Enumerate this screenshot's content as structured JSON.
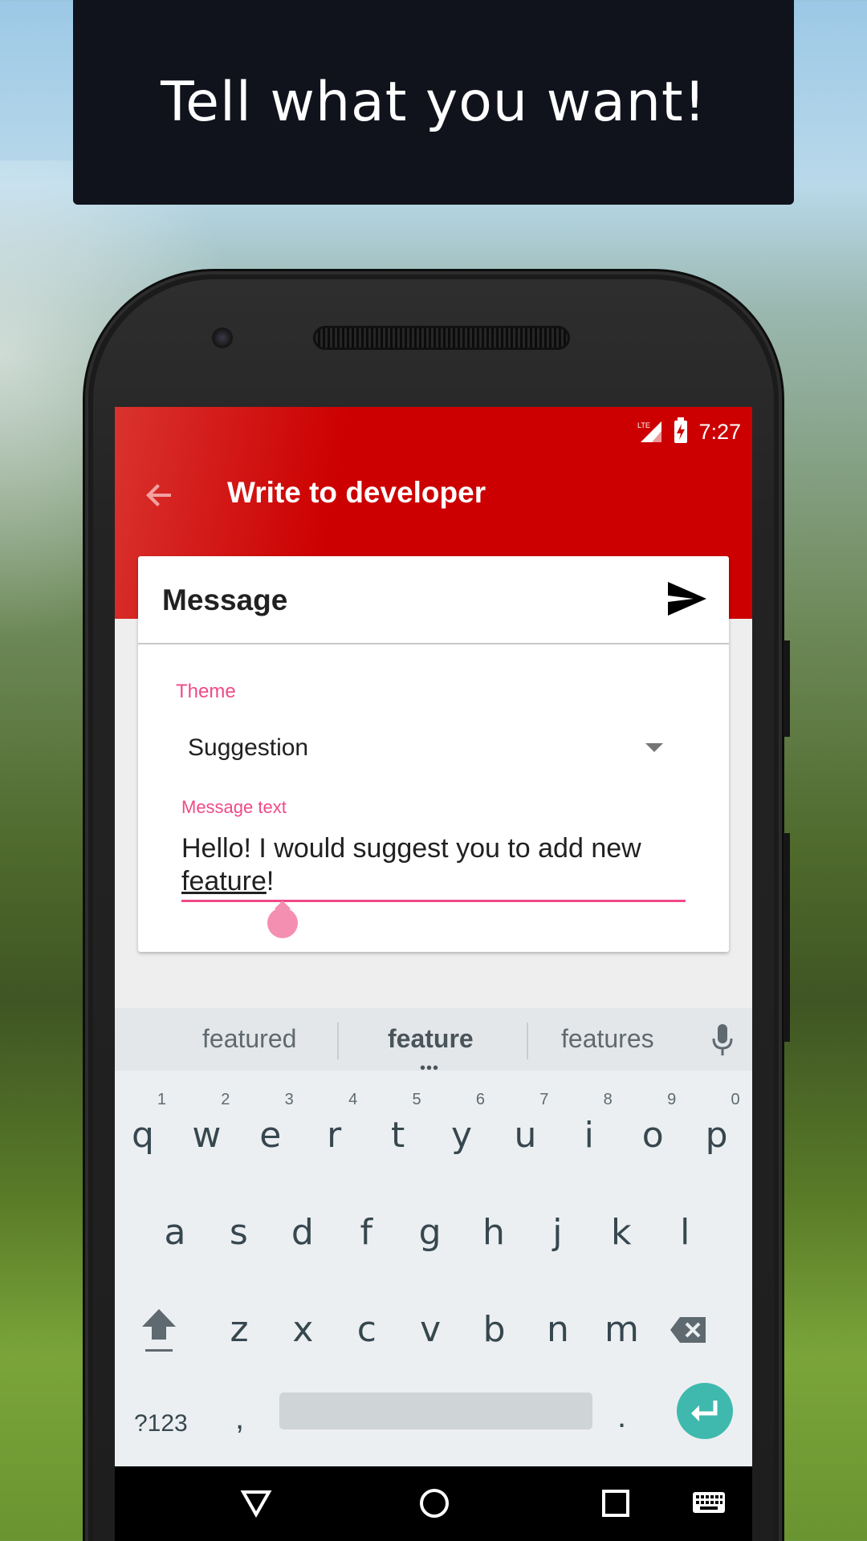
{
  "banner": {
    "title": "Tell what you want!"
  },
  "status_bar": {
    "time": "7:27",
    "network": "LTE"
  },
  "app_bar": {
    "title": "Write to developer"
  },
  "card": {
    "title": "Message",
    "theme_label": "Theme",
    "theme_value": "Suggestion",
    "message_label": "Message text",
    "message_text_part1": "Hello! I would suggest you to add new ",
    "message_text_underlined": "feature",
    "message_text_part2": "!"
  },
  "keyboard": {
    "suggestions": [
      "featured",
      "feature",
      "features"
    ],
    "row1": [
      {
        "ch": "q",
        "hint": "1"
      },
      {
        "ch": "w",
        "hint": "2"
      },
      {
        "ch": "e",
        "hint": "3"
      },
      {
        "ch": "r",
        "hint": "4"
      },
      {
        "ch": "t",
        "hint": "5"
      },
      {
        "ch": "y",
        "hint": "6"
      },
      {
        "ch": "u",
        "hint": "7"
      },
      {
        "ch": "i",
        "hint": "8"
      },
      {
        "ch": "o",
        "hint": "9"
      },
      {
        "ch": "p",
        "hint": "0"
      }
    ],
    "row2": [
      "a",
      "s",
      "d",
      "f",
      "g",
      "h",
      "j",
      "k",
      "l"
    ],
    "row3": [
      "z",
      "x",
      "c",
      "v",
      "b",
      "n",
      "m"
    ],
    "symbols_label": "?123",
    "comma": ",",
    "period": ".",
    "accent_color": "#3fb9ad"
  },
  "colors": {
    "app_bar": "#cc0000",
    "accent": "#ef4a87",
    "banner": "#11131c"
  },
  "icons": [
    "back-arrow-icon",
    "send-icon",
    "dropdown-arrow-icon",
    "mic-icon",
    "shift-icon",
    "backspace-icon",
    "enter-icon",
    "nav-back-icon",
    "nav-home-icon",
    "nav-recents-icon",
    "nav-keyboard-icon"
  ]
}
